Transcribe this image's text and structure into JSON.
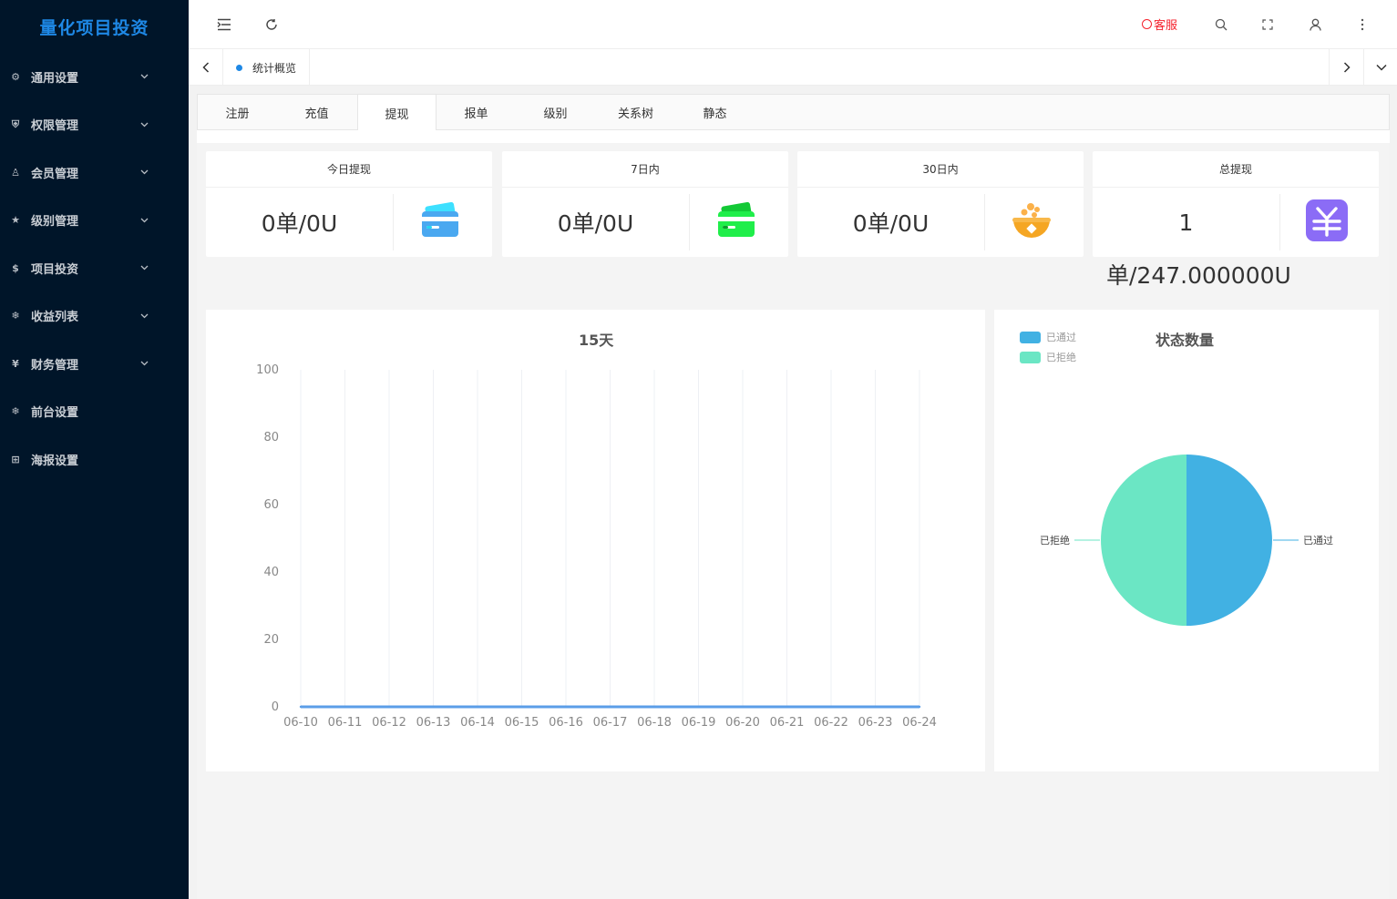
{
  "sidebar": {
    "logo": "量化项目投资",
    "items": [
      {
        "label": "通用设置",
        "icon": "gear-icon",
        "glyph": "⚙",
        "has_children": true
      },
      {
        "label": "权限管理",
        "icon": "shield-check-icon",
        "glyph": "⛨",
        "has_children": true
      },
      {
        "label": "会员管理",
        "icon": "user-icon",
        "glyph": "♙",
        "has_children": true
      },
      {
        "label": "级别管理",
        "icon": "star-icon",
        "glyph": "★",
        "has_children": true
      },
      {
        "label": "项目投资",
        "icon": "dollar-circle-icon",
        "glyph": "$",
        "has_children": true
      },
      {
        "label": "收益列表",
        "icon": "snowflake-icon",
        "glyph": "❄",
        "has_children": true
      },
      {
        "label": "财务管理",
        "icon": "yen-circle-icon",
        "glyph": "¥",
        "has_children": true
      },
      {
        "label": "前台设置",
        "icon": "snowflake-icon",
        "glyph": "❄",
        "has_children": false
      },
      {
        "label": "海报设置",
        "icon": "apps-add-icon",
        "glyph": "⊞",
        "has_children": false
      }
    ]
  },
  "header": {
    "customer_service": "客服"
  },
  "tabbar": {
    "active_page": "统计概览"
  },
  "subtabs": [
    "注册",
    "充值",
    "提现",
    "报单",
    "级别",
    "关系树",
    "静态"
  ],
  "active_subtab": "提现",
  "cards": [
    {
      "title": "今日提现",
      "value": "0单/0U",
      "icon": "credit-card-icon",
      "color": "#45a7f2"
    },
    {
      "title": "7日内",
      "value": "0单/0U",
      "icon": "credit-card-icon",
      "color": "#1ee84a"
    },
    {
      "title": "30日内",
      "value": "0单/0U",
      "icon": "treasure-bowl-icon",
      "color": "#f5a623"
    },
    {
      "title": "总提现",
      "value": "1",
      "value_overflow": "单/247.000000U",
      "icon": "yen-icon",
      "color": "#8b6cf6"
    }
  ],
  "line_chart_title": "15天",
  "pie_chart_title": "状态数量",
  "chart_data": [
    {
      "type": "line",
      "title": "15天",
      "x": [
        "06-10",
        "06-11",
        "06-12",
        "06-13",
        "06-14",
        "06-15",
        "06-16",
        "06-17",
        "06-18",
        "06-19",
        "06-20",
        "06-21",
        "06-22",
        "06-23",
        "06-24"
      ],
      "y_ticks": [
        0,
        20,
        40,
        60,
        80,
        100
      ],
      "ylim": [
        0,
        100
      ],
      "series": [
        {
          "values": [
            0,
            0,
            0,
            0,
            0,
            0,
            0,
            0,
            0,
            0,
            0,
            0,
            0,
            0,
            0
          ],
          "color": "#5b9ee8"
        }
      ],
      "grid": "vertical"
    },
    {
      "type": "pie",
      "title": "状态数量",
      "legend_position": "top-left",
      "slices": [
        {
          "name": "已通过",
          "value": 1,
          "color": "#41b1e3"
        },
        {
          "name": "已拒绝",
          "value": 1,
          "color": "#6be6c4"
        }
      ]
    }
  ]
}
